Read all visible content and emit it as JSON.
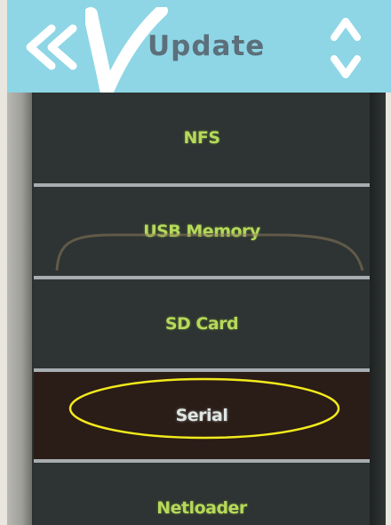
{
  "header": {
    "title": "Update",
    "back_icon": "double-chevron-left-icon",
    "logo_icon": "v-logo-icon",
    "up_icon": "arrow-up-icon",
    "down_icon": "arrow-down-icon",
    "background_color": "#8ed6e6"
  },
  "menu": {
    "items": [
      {
        "label": "NFS",
        "selected": false
      },
      {
        "label": "USB Memory",
        "selected": false
      },
      {
        "label": "SD Card",
        "selected": false
      },
      {
        "label": "Serial",
        "selected": true
      },
      {
        "label": "Netloader",
        "selected": false
      }
    ],
    "label_color": "#b6d95a",
    "selected_label_color": "#dfe6e4"
  },
  "annotation": {
    "shape": "ellipse",
    "color": "#f2ea1c",
    "target": "Serial"
  }
}
